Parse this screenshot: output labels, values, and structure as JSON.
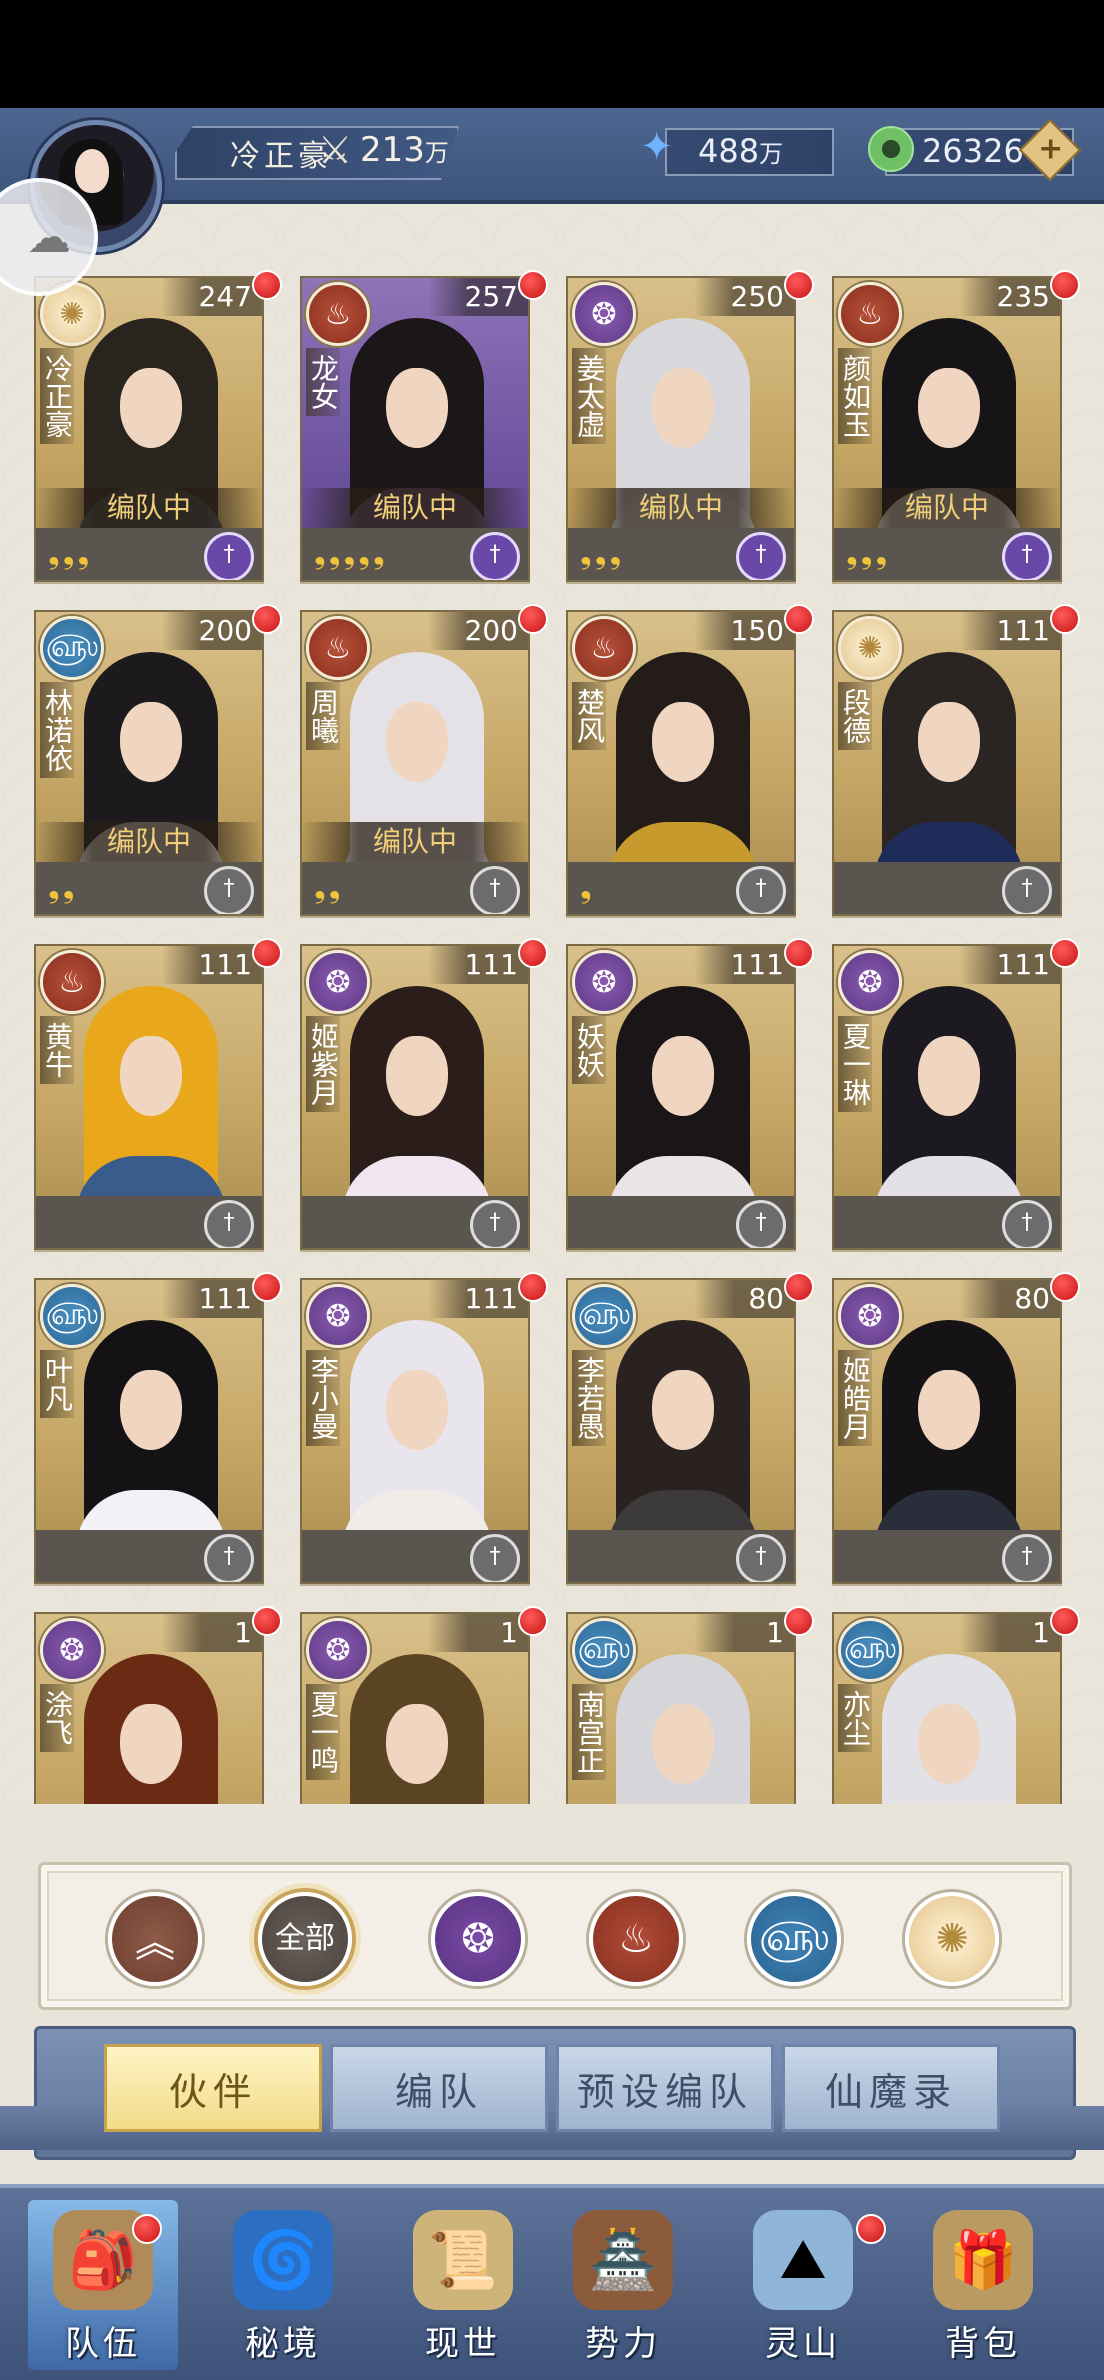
{
  "header": {
    "player_name": "冷正豪",
    "power": "213",
    "power_unit": "万",
    "crystals": "488",
    "crystals_unit": "万",
    "jade": "26326",
    "add_label": "+"
  },
  "heroes": [
    {
      "name": "冷正豪",
      "level": "247",
      "element": "light",
      "team": "编队中",
      "stars": "❟❟❟",
      "purple": false
    },
    {
      "name": "龙女",
      "level": "257",
      "element": "fire",
      "team": "编队中",
      "stars": "❟❟❟❟❟",
      "purple": true
    },
    {
      "name": "姜太虚",
      "level": "250",
      "element": "spirit",
      "team": "编队中",
      "stars": "❟❟❟",
      "purple": false
    },
    {
      "name": "颜如玉",
      "level": "235",
      "element": "fire",
      "team": "编队中",
      "stars": "❟❟❟",
      "purple": false
    },
    {
      "name": "林诺依",
      "level": "200",
      "element": "water",
      "team": "编队中",
      "stars": "❟❟",
      "purple": false
    },
    {
      "name": "周曦",
      "level": "200",
      "element": "fire",
      "team": "编队中",
      "stars": "❟❟",
      "purple": false
    },
    {
      "name": "楚风",
      "level": "150",
      "element": "fire",
      "team": "",
      "stars": "❟",
      "purple": false
    },
    {
      "name": "段德",
      "level": "111",
      "element": "light",
      "team": "",
      "stars": "",
      "purple": false
    },
    {
      "name": "黄牛",
      "level": "111",
      "element": "fire",
      "team": "",
      "stars": "",
      "purple": false
    },
    {
      "name": "姬紫月",
      "level": "111",
      "element": "spirit",
      "team": "",
      "stars": "",
      "purple": false
    },
    {
      "name": "妖妖",
      "level": "111",
      "element": "spirit",
      "team": "",
      "stars": "",
      "purple": false
    },
    {
      "name": "夏一琳",
      "level": "111",
      "element": "spirit",
      "team": "",
      "stars": "",
      "purple": false
    },
    {
      "name": "叶凡",
      "level": "111",
      "element": "water",
      "team": "",
      "stars": "",
      "purple": false
    },
    {
      "name": "李小曼",
      "level": "111",
      "element": "spirit",
      "team": "",
      "stars": "",
      "purple": false
    },
    {
      "name": "李若愚",
      "level": "80",
      "element": "water",
      "team": "",
      "stars": "",
      "purple": false
    },
    {
      "name": "姬皓月",
      "level": "80",
      "element": "spirit",
      "team": "",
      "stars": "",
      "purple": false
    },
    {
      "name": "涂飞",
      "level": "1",
      "element": "spirit",
      "team": "",
      "stars": "",
      "purple": false
    },
    {
      "name": "夏一鸣",
      "level": "1",
      "element": "spirit",
      "team": "",
      "stars": "",
      "purple": false
    },
    {
      "name": "南宫正",
      "level": "1",
      "element": "water",
      "team": "",
      "stars": "",
      "purple": false
    },
    {
      "name": "亦尘",
      "level": "1",
      "element": "water",
      "team": "",
      "stars": "",
      "purple": false
    }
  ],
  "filters": {
    "all_label": "全部"
  },
  "tabs": [
    "伙伴",
    "编队",
    "预设编队",
    "仙魔录"
  ],
  "nav": [
    "队伍",
    "秘境",
    "现世",
    "势力",
    "灵山",
    "背包"
  ],
  "colors": {
    "accent_gold": "#f1cf78",
    "notify_red": "#d81b1b",
    "header_blue": "#3d557c"
  }
}
